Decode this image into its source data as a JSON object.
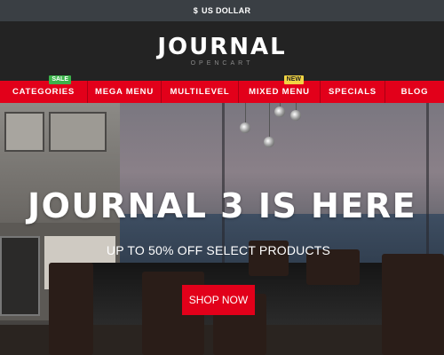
{
  "topbar": {
    "currency_symbol": "$",
    "currency_label": "US DOLLAR"
  },
  "logo": {
    "main": "JOURNAL",
    "sub": "OPENCART"
  },
  "nav": {
    "items": [
      {
        "label": "CATEGORIES",
        "badge": "SALE"
      },
      {
        "label": "MEGA MENU"
      },
      {
        "label": "MULTILEVEL"
      },
      {
        "label": "MIXED MENU",
        "badge": "NEW"
      },
      {
        "label": "SPECIALS"
      },
      {
        "label": "BLOG"
      }
    ]
  },
  "hero": {
    "title": "JOURNAL 3 IS HERE",
    "subtitle": "UP TO 50% OFF SELECT PRODUCTS",
    "cta_label": "SHOP NOW"
  },
  "colors": {
    "brand_red": "#e2001a",
    "sale_badge": "#3bb34a",
    "new_badge": "#f2d543",
    "header_bg": "#232323",
    "topbar_bg": "#3a3f44"
  }
}
